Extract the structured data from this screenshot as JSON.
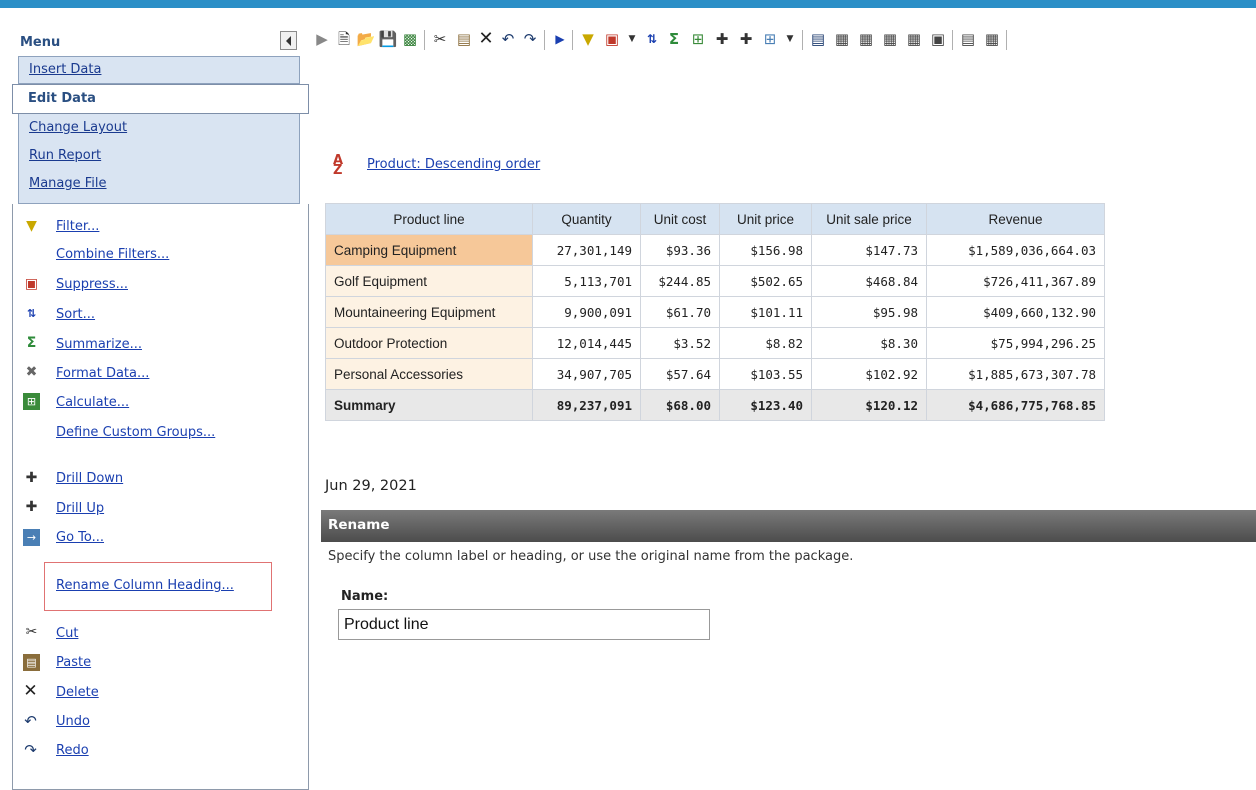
{
  "menu": {
    "title": "Menu",
    "items": [
      "Insert Data",
      "Edit Data",
      "Change Layout",
      "Run Report",
      "Manage File"
    ],
    "selected": "Edit Data"
  },
  "edit_commands": {
    "filter": "Filter...",
    "combine_filters": "Combine Filters...",
    "suppress": "Suppress...",
    "sort": "Sort...",
    "summarize": "Summarize...",
    "format_data": "Format Data...",
    "calculate": "Calculate...",
    "define_custom_groups": "Define Custom Groups...",
    "drill_down": "Drill Down",
    "drill_up": "Drill Up",
    "go_to": "Go To...",
    "rename_column_heading": "Rename Column Heading...",
    "cut": "Cut",
    "paste": "Paste",
    "delete": "Delete",
    "undo": "Undo",
    "redo": "Redo"
  },
  "toolbar": {
    "icons": [
      "insertable-objects-icon",
      "new-icon",
      "open-icon",
      "save-icon",
      "save-as-icon",
      "cut-icon",
      "paste-icon",
      "delete-icon",
      "undo-icon",
      "redo-icon",
      "run-icon",
      "filter-icon",
      "suppress-icon",
      "sort-icon",
      "summarize-icon",
      "calculate-icon",
      "drill-down-icon",
      "drill-up-icon",
      "go-to-icon",
      "chart-icon",
      "layout-icon"
    ]
  },
  "sort_label": "Product: Descending order",
  "table": {
    "headers": [
      "Product line",
      "Quantity",
      "Unit cost",
      "Unit price",
      "Unit sale price",
      "Revenue"
    ],
    "rows": [
      [
        "Camping Equipment",
        "27,301,149",
        "$93.36",
        "$156.98",
        "$147.73",
        "$1,589,036,664.03"
      ],
      [
        "Golf Equipment",
        "5,113,701",
        "$244.85",
        "$502.65",
        "$468.84",
        "$726,411,367.89"
      ],
      [
        "Mountaineering Equipment",
        "9,900,091",
        "$61.70",
        "$101.11",
        "$95.98",
        "$409,660,132.90"
      ],
      [
        "Outdoor Protection",
        "12,014,445",
        "$3.52",
        "$8.82",
        "$8.30",
        "$75,994,296.25"
      ],
      [
        "Personal Accessories",
        "34,907,705",
        "$57.64",
        "$103.55",
        "$102.92",
        "$1,885,673,307.78"
      ]
    ],
    "summary": [
      "Summary",
      "89,237,091",
      "$68.00",
      "$123.40",
      "$120.12",
      "$4,686,775,768.85"
    ]
  },
  "report_date": "Jun 29, 2021",
  "rename": {
    "title": "Rename",
    "description": "Specify the column label or heading, or use the original name from the package.",
    "name_label": "Name:",
    "name_value": "Product line"
  },
  "colors": {
    "topbar": "#2b8fc7",
    "menu_bg": "#d9e4f2",
    "highlight": "#e07373",
    "header_bg": "#d6e3f1"
  }
}
